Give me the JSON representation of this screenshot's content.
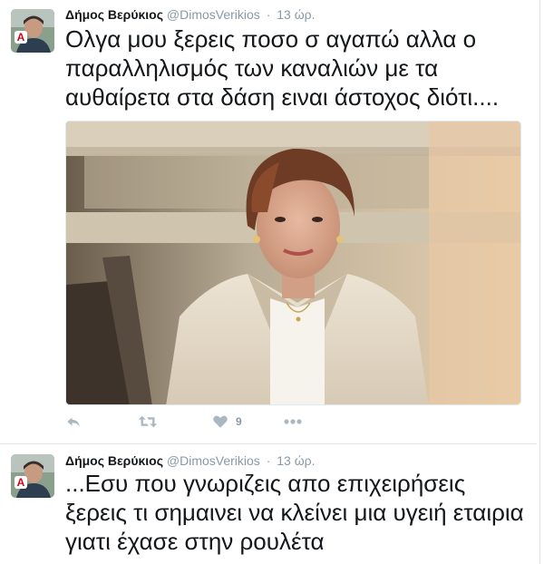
{
  "tweets": [
    {
      "author_name": "Δήμος Βερύκιος",
      "handle": "@DimosVerikios",
      "separator": "·",
      "time": "13 ώρ.",
      "text": "Ολγα μου ξερεις ποσο σ αγαπώ αλλα ο παραλληλισμός των καναλιών με τα αυθαίρετα στα δάση ειναι άστοχος διότι....",
      "image_icon": "woman-portrait-photo",
      "actions": {
        "reply_icon": "reply-icon",
        "retweet_icon": "retweet-icon",
        "like_icon": "heart-icon",
        "like_count": "9",
        "more_icon": "more-dots-icon"
      }
    },
    {
      "author_name": "Δήμος Βερύκιος",
      "handle": "@DimosVerikios",
      "separator": "·",
      "time": "13 ώρ.",
      "text": "...Εσυ που γνωριζεις απο επιχειρήσεις ξερεις τι σημαινει να κλείνει μια υγειή εταιρια  γιατι έχασε στην ρουλέτα"
    }
  ],
  "colors": {
    "text": "#14171a",
    "muted": "#8899a6",
    "icon": "#aab8c2",
    "divider": "#e1e8ed"
  }
}
